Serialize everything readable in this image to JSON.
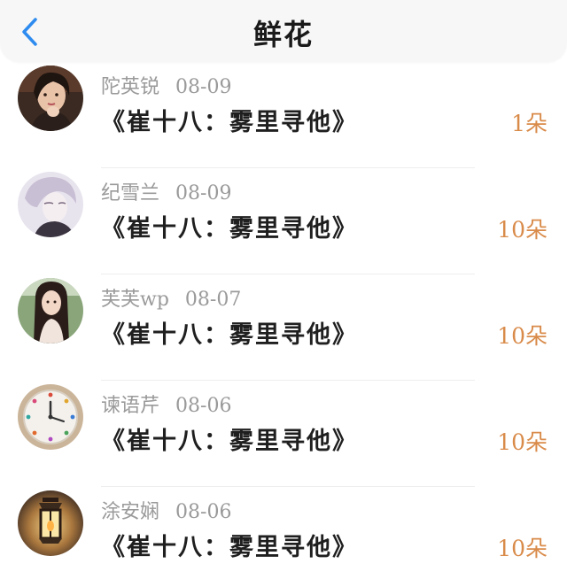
{
  "header": {
    "title": "鲜花",
    "back_icon": "chevron-left-icon",
    "accent": "#2e8bef"
  },
  "count_color": "#d98b4a",
  "items": [
    {
      "name": "陀英锐",
      "date": "08-09",
      "book": "《崔十八：雾里寻他》",
      "count": "1朵",
      "avatar": "woman-portrait-dark"
    },
    {
      "name": "纪雪兰",
      "date": "08-09",
      "book": "《崔十八：雾里寻他》",
      "count": "10朵",
      "avatar": "illustrated-boy-lavender"
    },
    {
      "name": "芙芙wp",
      "date": "08-07",
      "book": "《崔十八：雾里寻他》",
      "count": "10朵",
      "avatar": "girl-photo-green"
    },
    {
      "name": "谏语芹",
      "date": "08-06",
      "book": "《崔十八：雾里寻他》",
      "count": "10朵",
      "avatar": "wall-clock"
    },
    {
      "name": "涂安娴",
      "date": "08-06",
      "book": "《崔十八：雾里寻他》",
      "count": "10朵",
      "avatar": "lantern"
    }
  ]
}
